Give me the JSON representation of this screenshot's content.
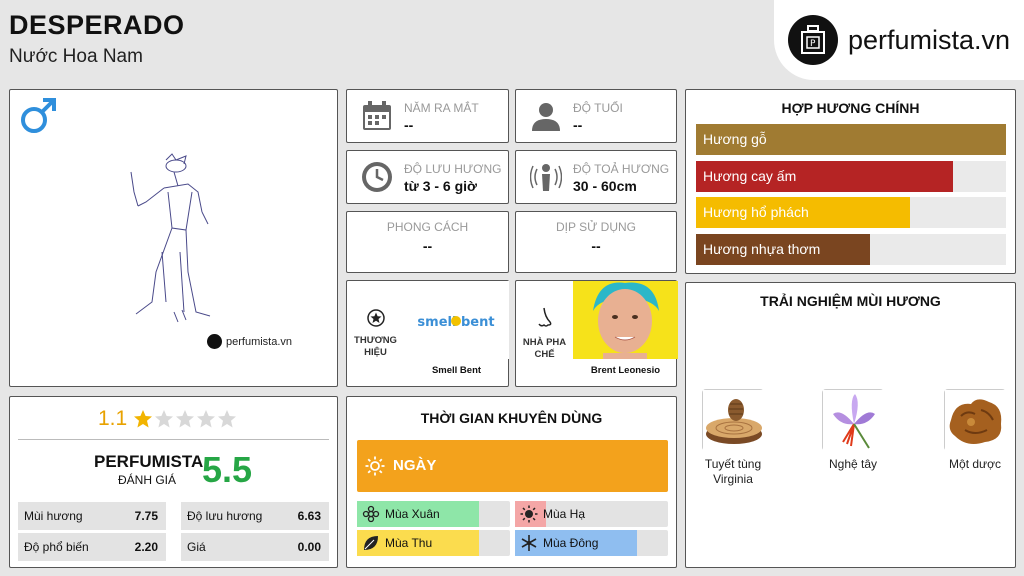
{
  "header": {
    "product_name": "DESPERADO",
    "subtitle": "Nước Hoa Nam",
    "logo_text": "perfumista.vn",
    "logo_icon": "perfume-bottle-logo-icon"
  },
  "image_panel": {
    "gender_icon": "male-symbol-icon",
    "watermark": "perfumista.vn"
  },
  "info": {
    "release_year": {
      "label": "NĂM RA MẮT",
      "value": "--",
      "icon": "calendar-icon"
    },
    "age": {
      "label": "ĐỘ TUỔI",
      "value": "--",
      "icon": "person-icon"
    },
    "longevity": {
      "label": "ĐỘ LƯU HƯƠNG",
      "value": "từ 3 - 6 giờ",
      "icon": "clock-icon"
    },
    "sillage": {
      "label": "ĐỘ TOẢ HƯƠNG",
      "value": "30 - 60cm",
      "icon": "radiating-person-icon"
    },
    "style": {
      "label": "PHONG CÁCH",
      "value": "--"
    },
    "occasion": {
      "label": "DỊP SỬ DỤNG",
      "value": "--"
    }
  },
  "brand": {
    "label": "THƯƠNG HIỆU",
    "name": "Smell Bent",
    "logo_text": "smell bent",
    "icon": "star-badge-icon"
  },
  "perfumer": {
    "label": "NHÀ PHA CHẾ",
    "name": "Brent Leonesio",
    "icon": "nose-icon"
  },
  "accords": {
    "title": "HỢP HƯƠNG CHÍNH",
    "items": [
      {
        "label": "Hương gỗ",
        "percent": 100,
        "color": "#a07b32"
      },
      {
        "label": "Hương cay ấm",
        "percent": 83,
        "color": "#b52424"
      },
      {
        "label": "Hương hổ phách",
        "percent": 69,
        "color": "#f5bc00"
      },
      {
        "label": "Hương nhựa thơm",
        "percent": 56,
        "color": "#7a4520"
      }
    ]
  },
  "experience": {
    "title": "TRẢI NGHIỆM MÙI HƯƠNG",
    "notes": [
      {
        "label": "Tuyết tùng Virginia"
      },
      {
        "label": "Nghệ tây"
      },
      {
        "label": "Một dược"
      }
    ]
  },
  "rating": {
    "score": "1.1",
    "stars_filled": 1,
    "stars_total": 5,
    "perfumista_label": "PERFUMISTA",
    "perfumista_sub": "ĐÁNH GIÁ",
    "perfumista_score": "5.5",
    "stats": [
      {
        "label": "Mùi hương",
        "value": "7.75"
      },
      {
        "label": "Độ lưu hương",
        "value": "6.63"
      },
      {
        "label": "Độ phổ biến",
        "value": "2.20"
      },
      {
        "label": "Giá",
        "value": "0.00"
      }
    ]
  },
  "time": {
    "title": "THỜI GIAN KHUYÊN DÙNG",
    "day_label": "NGÀY",
    "day_icon": "sun-icon",
    "seasons": [
      {
        "label": "Mùa Xuân",
        "percent": 80,
        "color": "#8ee6a8",
        "icon": "flower-icon"
      },
      {
        "label": "Mùa Hạ",
        "percent": 20,
        "color": "#f4a6a6",
        "icon": "sun-icon"
      },
      {
        "label": "Mùa Thu",
        "percent": 80,
        "color": "#fbdc4e",
        "icon": "leaf-icon"
      },
      {
        "label": "Mùa Đông",
        "percent": 80,
        "color": "#8fbef0",
        "icon": "snowflake-icon"
      }
    ]
  }
}
